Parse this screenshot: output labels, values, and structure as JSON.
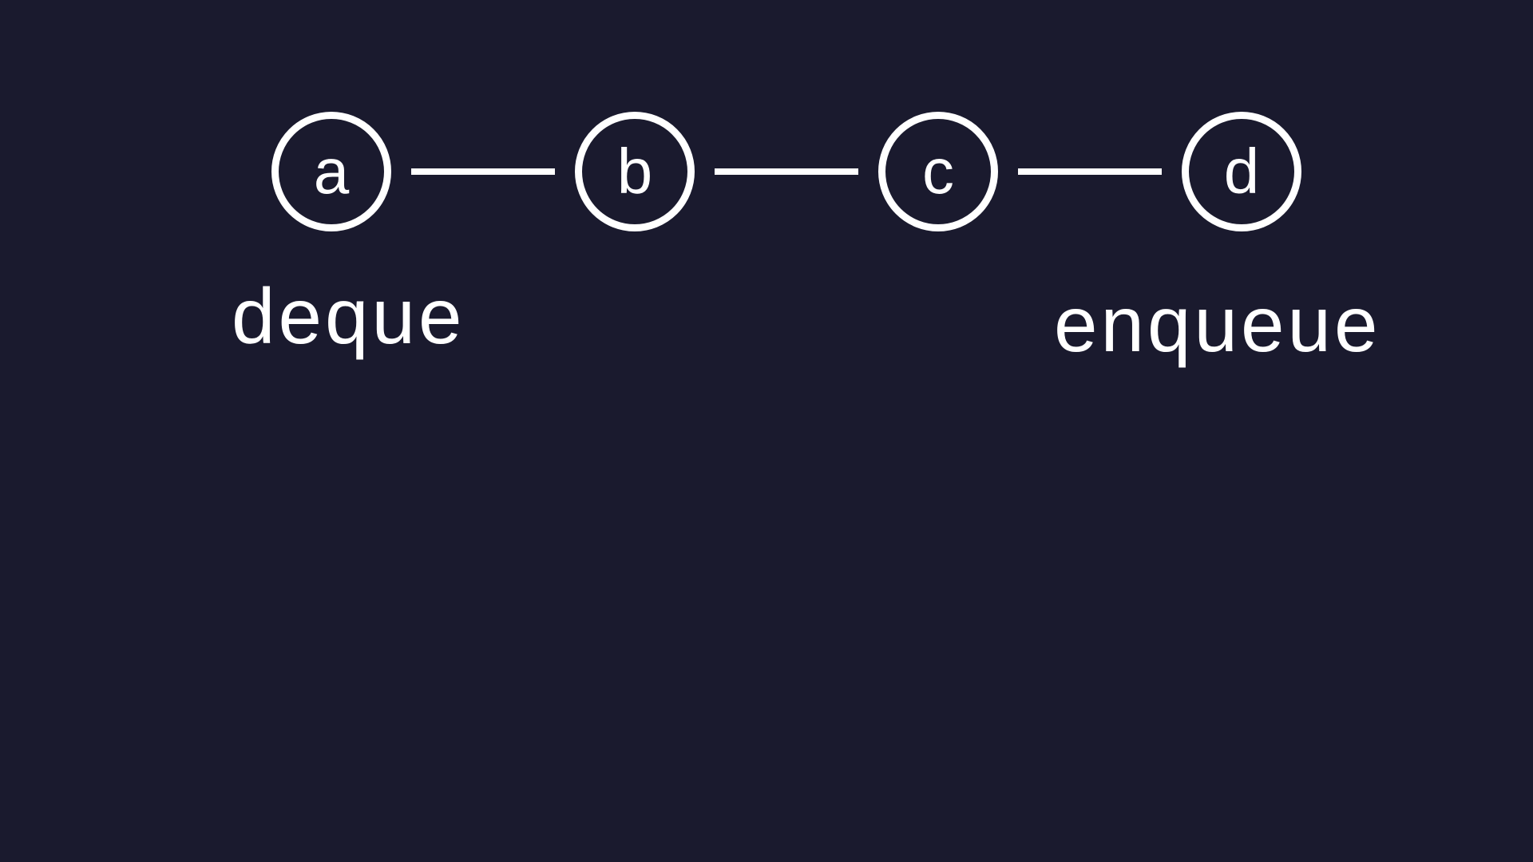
{
  "diagram": {
    "nodes": [
      {
        "label": "a"
      },
      {
        "label": "b"
      },
      {
        "label": "c"
      },
      {
        "label": "d"
      }
    ],
    "labels": {
      "left": "deque",
      "right": "enqueue"
    }
  }
}
